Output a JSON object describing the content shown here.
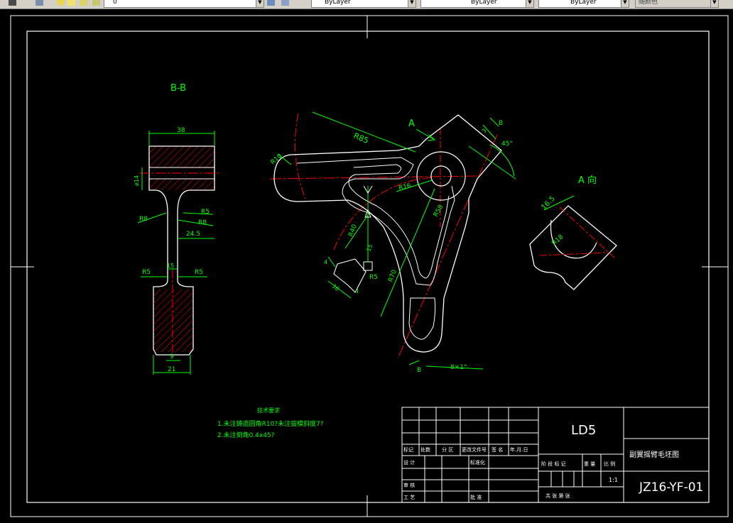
{
  "toolbar": {
    "layer_value": "0",
    "color_value": "ByLayer",
    "linetype_value": "ByLayer",
    "lineweight_value": "ByLayer",
    "plotstyle_value": "随颜色"
  },
  "drawing": {
    "section_label": "B-B",
    "view_label": "A 向",
    "arrow_label_a": "A",
    "arrow_label_b": "B",
    "arrow_label_b2": "B",
    "dims_section": {
      "d38": "38",
      "d14": "ø14",
      "r8": "R8",
      "r5a": "R5",
      "r8b": "R8",
      "d245": "24.5",
      "d15": "15",
      "r5b": "R5",
      "r5c": "R5",
      "d9": "9",
      "d21": "21"
    },
    "dims_main": {
      "r85": "R85",
      "r10": "R10",
      "r16": "R16",
      "r58": "R58",
      "r40": "R40",
      "r70": "R70",
      "r5": "R5",
      "d4a": "4",
      "d4b": "4",
      "d16": "16",
      "d15": "15",
      "d45": "45°",
      "d3": "3",
      "d8": "8×1°"
    },
    "dims_view": {
      "d165": "16.5",
      "r18": "R18"
    },
    "notes": {
      "title": "技术要求",
      "line1": "1.未注铸造圆角R10?未注拔模斜度7?",
      "line2": "2.未注倒角0.4x45?"
    },
    "title_block": {
      "material": "LD5",
      "part_name": "副翼摇臂毛坯图",
      "drawing_no": "JZ16-YF-01",
      "scale": "1:1",
      "cells": {
        "biaoji": "标记",
        "chushu": "处数",
        "fenqu": "分 区",
        "gengai": "更改文件号",
        "qianming": "签 名",
        "nianyueri": "年.月.日",
        "sheji": "设 计",
        "biaozhunhua": "标准化",
        "jieduan": "阶 段 标 记",
        "zhongliang": "重 量",
        "bili": "比 例",
        "shenhe": "审 核",
        "gongyi": "工 艺",
        "pizhun": "批 准",
        "gongzhang": "共   张   第   张"
      }
    }
  },
  "colors": {
    "background": "#000000",
    "outline": "#ffffff",
    "dimension": "#00ff00",
    "centerline": "#ff0000",
    "hatch": "#ff0000",
    "label": "#00ff00"
  }
}
